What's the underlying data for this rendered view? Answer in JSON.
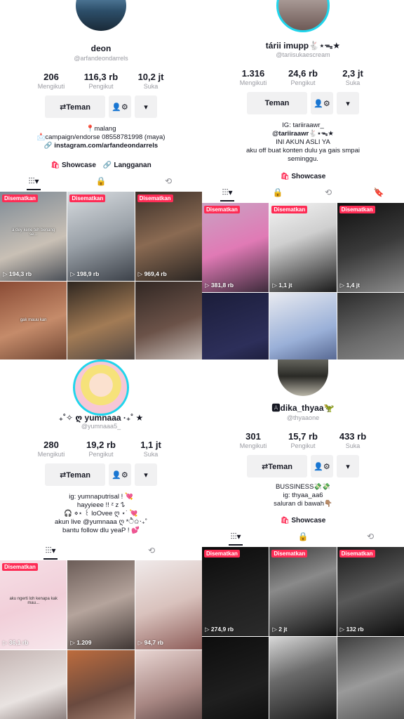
{
  "panels": [
    {
      "name": "deon",
      "handle": "@arfandeondarrels",
      "stats": [
        {
          "value": "206",
          "label": "Mengikuti"
        },
        {
          "value": "116,3 rb",
          "label": "Pengikut"
        },
        {
          "value": "10,2 jt",
          "label": "Suka"
        }
      ],
      "actions": {
        "main": "⇄Teman",
        "add_icon": "person-settings-icon",
        "more_icon": "caret-down-icon"
      },
      "bio": [
        "📍malang",
        "📩campaign/endorse 08558781998 (maya)",
        "🔗 instagram.com/arfandeondarrels"
      ],
      "links": [
        {
          "icon": "🛍",
          "label": "Showcase"
        },
        {
          "icon": "🔗",
          "label": "Langganan"
        }
      ],
      "tabs": [
        "⫶⫶⫶▾",
        "🔒",
        "⟲"
      ],
      "videos": [
        {
          "pinned": "Disematkan",
          "views": "194,3 rb",
          "bg": "linear-gradient(160deg,#7d8a96,#c9c0b5 60%,#4a4f57)",
          "caption": "a dey kene teh benang se..."
        },
        {
          "pinned": "Disematkan",
          "views": "198,9 rb",
          "bg": "linear-gradient(160deg,#d9dde1,#9aa1a8 50%,#3c4149)",
          "caption": ""
        },
        {
          "pinned": "Disematkan",
          "views": "969,4 rb",
          "bg": "linear-gradient(160deg,#3a2e28,#8a6a52 50%,#2a2522)",
          "caption": ""
        },
        {
          "pinned": "",
          "views": "",
          "bg": "linear-gradient(160deg,#8a4b35,#c58b6a 50%,#5a3526)",
          "caption": "gak mauu kan"
        },
        {
          "pinned": "",
          "views": "",
          "bg": "linear-gradient(160deg,#2e2620,#a27b55 50%,#3d3a3e)",
          "caption": ""
        },
        {
          "pinned": "",
          "views": "",
          "bg": "linear-gradient(160deg,#312723,#6b5248 50%,#ddd7d3)",
          "caption": ""
        }
      ]
    },
    {
      "name": "tárii imupp🐇⋆ᯓ★",
      "handle": "@tariisukaescream",
      "stats": [
        {
          "value": "1.316",
          "label": "Mengikuti"
        },
        {
          "value": "24,6 rb",
          "label": "Pengikut"
        },
        {
          "value": "2,3 jt",
          "label": "Suka"
        }
      ],
      "actions": {
        "main": "Teman",
        "add_icon": "person-settings-icon",
        "more_icon": "caret-down-icon"
      },
      "bio": [
        "IG: tariiraawr_",
        "@tariiraawr🐇⋆ᯓ★",
        "INI AKUN ASLI YA",
        "aku off buat konten dulu ya gais smpai",
        "seminggu."
      ],
      "links": [
        {
          "icon": "🛍",
          "label": "Showcase"
        }
      ],
      "tabs": [
        "⫶⫶⫶▾",
        "🔒",
        "⟲",
        "🔖"
      ],
      "videos": [
        {
          "pinned": "Disematkan",
          "views": "381,8 rb",
          "bg": "linear-gradient(160deg,#c9a2c3,#e07ab5 50%,#3d2b3b)",
          "caption": ""
        },
        {
          "pinned": "Disematkan",
          "views": "1,1 jt",
          "bg": "linear-gradient(160deg,#f4f4f4,#cfcfcf 40%,#1a1a1a)",
          "caption": ""
        },
        {
          "pinned": "Disematkan",
          "views": "1,4 jt",
          "bg": "linear-gradient(160deg,#101010,#3a3a3a 50%,#8a8a8a)",
          "caption": ""
        },
        {
          "pinned": "",
          "views": "",
          "bg": "linear-gradient(160deg,#1b1d3a,#2d2f5a 60%,#101124)",
          "caption": ""
        },
        {
          "pinned": "",
          "views": "",
          "bg": "linear-gradient(160deg,#e8eaf0,#9ab0d8 50%,#2d3b66)",
          "caption": ""
        },
        {
          "pinned": "",
          "views": "",
          "bg": "linear-gradient(160deg,#2b2b2b,#6b6b6b 50%,#9a9a9a)",
          "caption": ""
        }
      ]
    },
    {
      "name": "₊˚✧ ღ yumnaaa ·₊˚ ★",
      "handle": "@yumnaaa5_",
      "stats": [
        {
          "value": "280",
          "label": "Mengikuti"
        },
        {
          "value": "19,2 rb",
          "label": "Pengikut"
        },
        {
          "value": "1,1 jt",
          "label": "Suka"
        }
      ],
      "actions": {
        "main": "⇄Teman",
        "add_icon": "person-settings-icon",
        "more_icon": "caret-down-icon"
      },
      "bio": [
        "ig: yumnaputrisal ! 💘",
        "hayyieee !! ᶻ z 𐰁",
        "🎧 ⋄⋆ ꒰ loOvee ღ ⋆˙ 💘",
        "akun live @yumnaaa ღ *ੈ✩‧₊˚",
        "bantu follow dlu yeaP ! 💕"
      ],
      "links": [],
      "tabs": [
        "⫶⫶⫶▾",
        "⟲"
      ],
      "videos": [
        {
          "pinned": "Disematkan",
          "views": "36,1 rb",
          "bg": "linear-gradient(160deg,#f6dfe6,#f1cfd9 50%,#f7e7ec)",
          "caption": "aku ngerti loh kenapa kak mau..."
        },
        {
          "pinned": "",
          "views": "1.209",
          "bg": "linear-gradient(160deg,#6b5c57,#b5a49c 50%,#3f3633)",
          "caption": ""
        },
        {
          "pinned": "",
          "views": "94,7 rb",
          "bg": "linear-gradient(160deg,#f0eaea,#d9c2bd 50%,#8d5c58)",
          "caption": ""
        },
        {
          "pinned": "",
          "views": "",
          "bg": "linear-gradient(160deg,#c6b7b5,#e9e3e1 50%,#5a4a48)",
          "caption": ""
        },
        {
          "pinned": "",
          "views": "",
          "bg": "linear-gradient(160deg,#bd6c3d,#6a4a3f 50%,#c7a291)",
          "caption": ""
        },
        {
          "pinned": "",
          "views": "",
          "bg": "linear-gradient(160deg,#e9d6d3,#a88783 50%,#3b2a29)",
          "caption": ""
        }
      ]
    },
    {
      "name": "🅰dika_thyaa🦖",
      "handle": "@thyaaone",
      "stats": [
        {
          "value": "301",
          "label": "Mengikuti"
        },
        {
          "value": "15,7 rb",
          "label": "Pengikut"
        },
        {
          "value": "433 rb",
          "label": "Suka"
        }
      ],
      "actions": {
        "main": "⇄Teman",
        "add_icon": "person-settings-icon",
        "more_icon": "caret-down-icon"
      },
      "bio": [
        "BUSSINESS💸💸",
        "ig: thyaa_aa6",
        "saluran di bawah👇🏽"
      ],
      "links": [
        {
          "icon": "🛍",
          "label": "Showcase"
        }
      ],
      "tabs": [
        "⫶⫶⫶▾",
        "🔒",
        "⟲"
      ],
      "videos": [
        {
          "pinned": "Disematkan",
          "views": "274,9 rb",
          "bg": "linear-gradient(160deg,#0b0b0b,#1e1e1e 50%,#2b2b2b)",
          "caption": ""
        },
        {
          "pinned": "Disematkan",
          "views": "2 jt",
          "bg": "linear-gradient(160deg,#3a3a3a,#8a8a8a 40%,#111)",
          "caption": ""
        },
        {
          "pinned": "Disematkan",
          "views": "132 rb",
          "bg": "linear-gradient(160deg,#1a1a1a,#595959 50%,#0d0d0d)",
          "caption": ""
        },
        {
          "pinned": "",
          "views": "",
          "bg": "linear-gradient(160deg,#0d0d0d,#1f1f1f 60%,#0d0d0d)",
          "caption": ""
        },
        {
          "pinned": "",
          "views": "",
          "bg": "linear-gradient(160deg,#d8d8d8,#6b6b6b 40%,#111)",
          "caption": ""
        },
        {
          "pinned": "",
          "views": "",
          "bg": "linear-gradient(160deg,#3d3d3d,#9a9a9a 50%,#4a4a4a)",
          "caption": ""
        }
      ]
    }
  ]
}
